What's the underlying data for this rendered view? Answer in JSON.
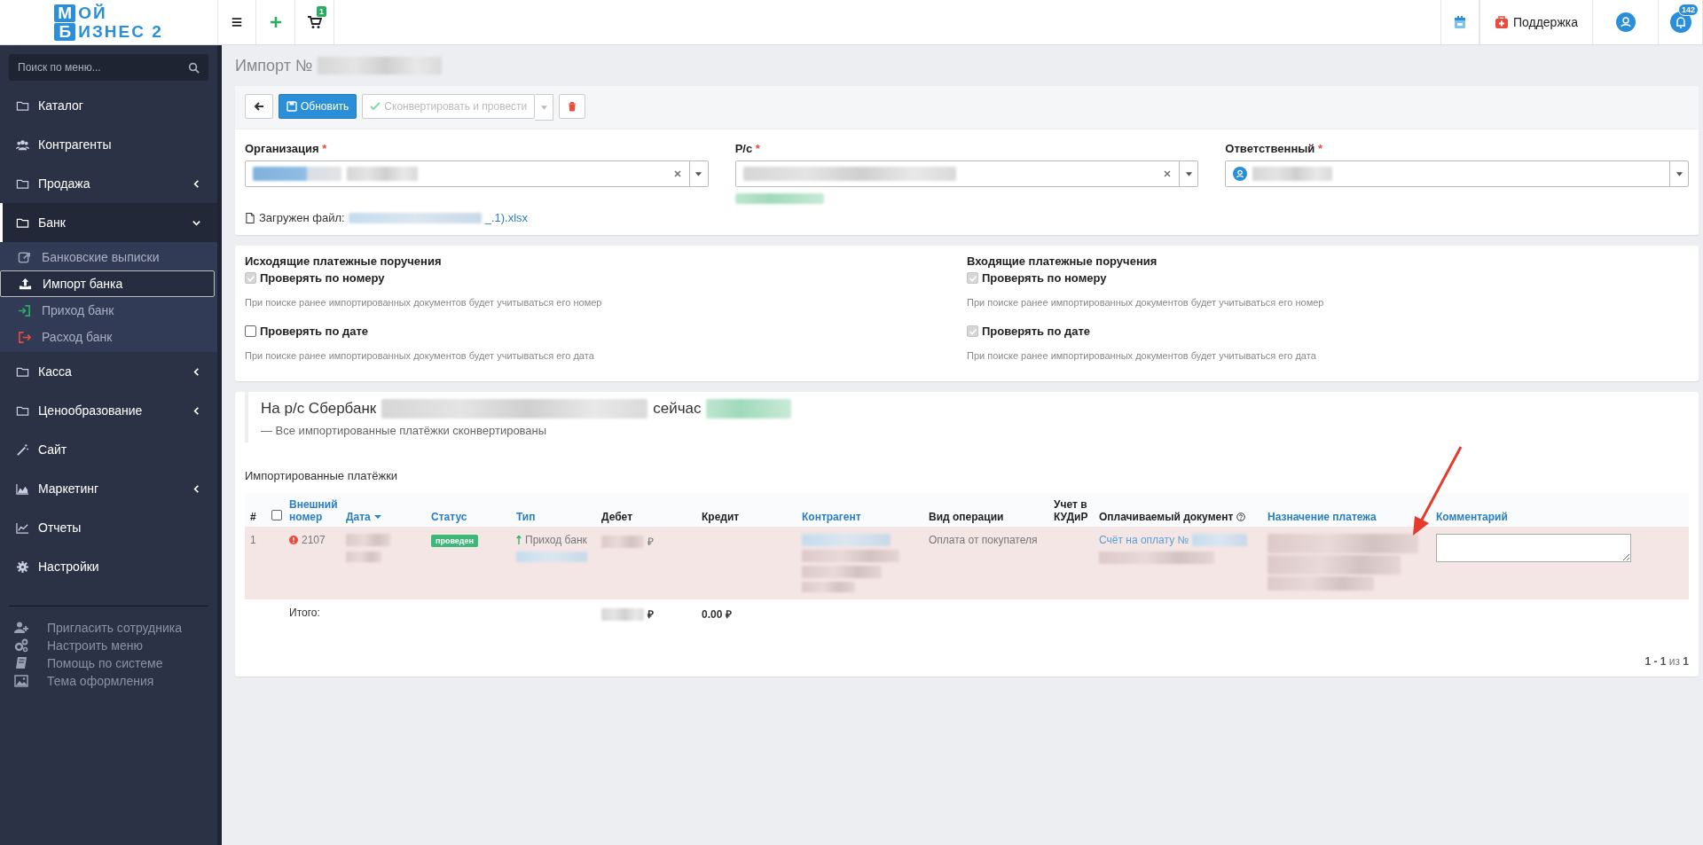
{
  "topbar": {
    "logo": {
      "line1": "ОЙ",
      "line2": "ИЗНЕС 2",
      "initial1": "М",
      "initial2": "Б"
    },
    "cart_badge": "1",
    "support": "Поддержка",
    "notifications_badge": "142"
  },
  "sidebar": {
    "search": {
      "placeholder": "Поиск по меню..."
    },
    "items": [
      {
        "label": "Каталог"
      },
      {
        "label": "Контрагенты"
      },
      {
        "label": "Продажа",
        "expanded": false
      },
      {
        "label": "Банк",
        "expanded": true,
        "children": [
          {
            "label": "Банковские выписки",
            "selected": false
          },
          {
            "label": "Импорт банка",
            "selected": true
          },
          {
            "label": "Приход банк",
            "selected": false
          },
          {
            "label": "Расход банк",
            "selected": false
          }
        ]
      },
      {
        "label": "Касса",
        "expanded": false
      },
      {
        "label": "Ценообразование",
        "expanded": false
      },
      {
        "label": "Сайт"
      },
      {
        "label": "Маркетинг",
        "expanded": false
      },
      {
        "label": "Отчеты"
      },
      {
        "label": "Настройки"
      }
    ],
    "footer_links": [
      "Пригласить сотрудника",
      "Настроить меню",
      "Помощь по системе",
      "Тема оформления"
    ]
  },
  "page_title": "Импорт №",
  "toolbar": [
    {
      "kind": "back"
    },
    {
      "kind": "primary",
      "label": "Обновить"
    },
    {
      "kind": "split",
      "label": "Сконвертировать и провести",
      "disabled": true
    },
    {
      "kind": "delete"
    }
  ],
  "fields": [
    {
      "label": "Организация",
      "required_mark": "*",
      "clearable": true,
      "avatar": false
    },
    {
      "label": "Р/с",
      "required_mark": "*",
      "clearable": true,
      "avatar": false
    },
    {
      "label": "Ответственный",
      "required_mark": "*",
      "clearable": false,
      "avatar": true
    }
  ],
  "file": {
    "label": "Загружен файл:",
    "link": "_.1).xlsx"
  },
  "check_sections": [
    {
      "title": "Исходящие платежные поручения",
      "options": [
        {
          "label": "Проверять по номеру",
          "checked": true,
          "disabled": true,
          "hint": "При поиске ранее импортированных документов будет учитываться его номер"
        },
        {
          "label": "Проверять по дате",
          "checked": false,
          "disabled": false,
          "hint": "При поиске ранее импортированных документов будет учитываться его дата"
        }
      ]
    },
    {
      "title": "Входящие платежные поручения",
      "options": [
        {
          "label": "Проверять по номеру",
          "checked": true,
          "disabled": true,
          "hint": "При поиске ранее импортированных документов будет учитываться его номер"
        },
        {
          "label": "Проверять по дате",
          "checked": true,
          "disabled": true,
          "hint": "При поиске ранее импортированных документов будет учитываться его дата"
        }
      ]
    }
  ],
  "summary": {
    "prefix": "На р/с Сбербанк",
    "middle": "сейчас",
    "note": "— Все импортированные платёжки сконвертированы"
  },
  "table": {
    "title": "Импортированные платёжки",
    "columns": [
      {
        "label": "#",
        "sortable": false,
        "sorted": false
      },
      {
        "kind": "checkbox",
        "checked": false
      },
      {
        "label": "Внешний номер",
        "sortable": true,
        "sorted": false
      },
      {
        "label": "Дата",
        "sortable": true,
        "sorted": true
      },
      {
        "label": "Статус",
        "sortable": true,
        "sorted": false
      },
      {
        "label": "Тип",
        "sortable": true,
        "sorted": false
      },
      {
        "label": "Дебет",
        "sortable": false,
        "sorted": false
      },
      {
        "label": "Кредит",
        "sortable": false,
        "sorted": false
      },
      {
        "label": "Контрагент",
        "sortable": true,
        "sorted": false
      },
      {
        "label": "Вид операции",
        "sortable": false,
        "sorted": false
      },
      {
        "label": "Учет в КУДиР",
        "sortable": false,
        "sorted": false
      },
      {
        "label": "Оплачиваемый документ",
        "sortable": false,
        "sorted": false,
        "help": true
      },
      {
        "label": "Назначение платежа",
        "sortable": true,
        "sorted": false
      },
      {
        "label": "Комментарий",
        "sortable": true,
        "sorted": false
      }
    ],
    "rows": [
      {
        "index": "1",
        "warning": true,
        "number": "2107",
        "status": "проведен",
        "type": "Приход банк",
        "debit_currency": "₽",
        "operation": "Оплата от покупателя",
        "document": "Счёт на оплату №"
      }
    ],
    "total": {
      "label": "Итого:",
      "debit_currency": "₽",
      "credit": "0.00 ₽"
    }
  },
  "pagination": "**1 - 1** из **1**"
}
